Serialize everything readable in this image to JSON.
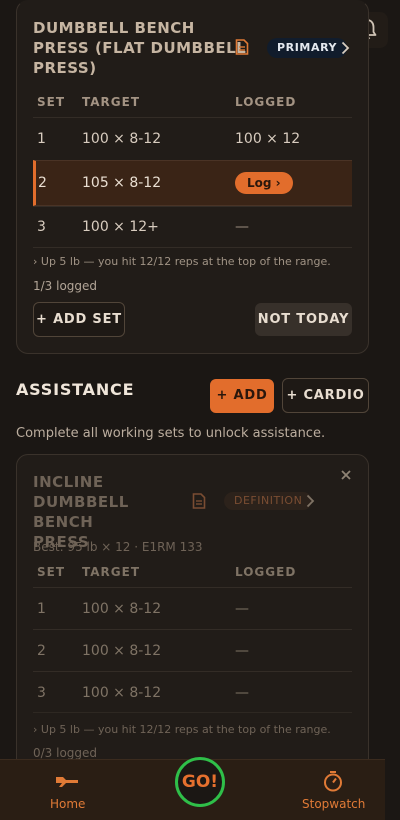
{
  "primary_exercise": {
    "title_lines": [
      "DUMBBELL BENCH",
      "PRESS (FLAT DUMBBELL",
      "PRESS)"
    ],
    "badge": "PRIMARY",
    "headers": {
      "set": "SET",
      "target": "TARGET",
      "logged": "LOGGED"
    },
    "sets": [
      {
        "set": "1",
        "target": "100 × 8-12",
        "logged": "100 × 12"
      },
      {
        "set": "2",
        "target": "105 × 8-12",
        "logged": "Log ›"
      },
      {
        "set": "3",
        "target": "100 × 12+",
        "logged": "—"
      }
    ],
    "hint": "›  Up 5 lb — you hit 12/12 reps at the top of the range.",
    "progress": "1/3 logged",
    "add_set": "+ ADD SET",
    "not_today": "NOT TODAY"
  },
  "assistance": {
    "title": "ASSISTANCE",
    "add_label": "+ ADD",
    "cardio_label": "+ CARDIO",
    "subtitle": "Complete all working sets to unlock assistance.",
    "exercise": {
      "title_lines": [
        "INCLINE",
        "DUMBBELL BENCH",
        "PRESS"
      ],
      "badge": "DEFINITION",
      "best": "Best: 95 lb × 12 · E1RM 133",
      "headers": {
        "set": "SET",
        "target": "TARGET",
        "logged": "LOGGED"
      },
      "sets": [
        {
          "set": "1",
          "target": "100 × 8-12",
          "logged": "—"
        },
        {
          "set": "2",
          "target": "100 × 8-12",
          "logged": "—"
        },
        {
          "set": "3",
          "target": "100 × 8-12",
          "logged": "—"
        }
      ],
      "hint": "›  Up 5 lb — you hit 12/12 reps at the top of the range.",
      "progress": "0/3 logged"
    }
  },
  "nav": {
    "home": "Home",
    "go": "GO!",
    "stopwatch": "Stopwatch"
  },
  "colors": {
    "accent": "#e26d2c",
    "go_ring": "#2fbf49",
    "background": "#1b1714"
  },
  "icons": [
    "bell-icon",
    "note-icon",
    "chevron-right-icon",
    "close-icon",
    "dumbbell-icon",
    "stopwatch-icon"
  ]
}
